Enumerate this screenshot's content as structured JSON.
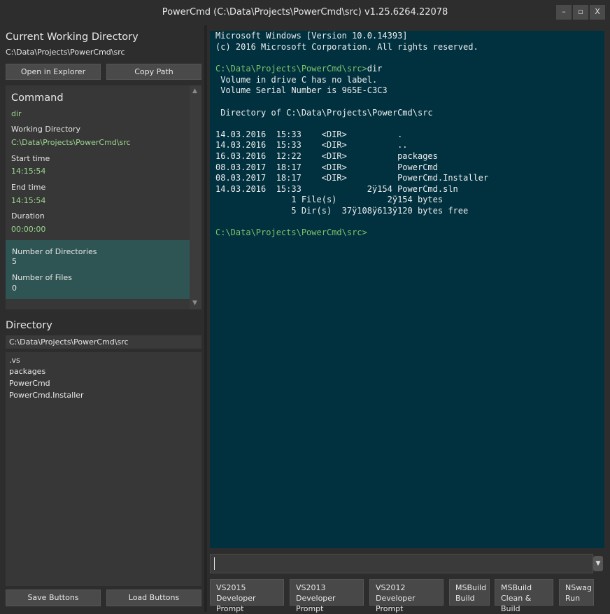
{
  "window": {
    "title": "PowerCmd (C:\\Data\\Projects\\PowerCmd\\src) v1.25.6264.22078",
    "minimize": "–",
    "maximize": "▫",
    "close": "X"
  },
  "cwd": {
    "heading": "Current Working Directory",
    "path": "C:\\Data\\Projects\\PowerCmd\\src",
    "open_explorer": "Open in Explorer",
    "copy_path": "Copy Path"
  },
  "command_info": {
    "heading": "Command",
    "command": "dir",
    "wd_label": "Working Directory",
    "wd_value": "C:\\Data\\Projects\\PowerCmd\\src",
    "start_label": "Start time",
    "start_value": "14:15:54",
    "end_label": "End time",
    "end_value": "14:15:54",
    "duration_label": "Duration",
    "duration_value": "00:00:00",
    "dirs_label": "Number of Directories",
    "dirs_value": "5",
    "files_label": "Number of Files",
    "files_value": "0"
  },
  "directory": {
    "heading": "Directory",
    "path": "C:\\Data\\Projects\\PowerCmd\\src",
    "items": [
      ".vs",
      "packages",
      "PowerCmd",
      "PowerCmd.Installer"
    ]
  },
  "bottom_buttons": {
    "save": "Save Buttons",
    "load": "Load Buttons"
  },
  "terminal": {
    "lines": [
      {
        "text": "Microsoft Windows [Version 10.0.14393]"
      },
      {
        "text": "(c) 2016 Microsoft Corporation. All rights reserved."
      },
      {
        "text": ""
      },
      {
        "prompt": "C:\\Data\\Projects\\PowerCmd\\src>",
        "text": "dir"
      },
      {
        "text": " Volume in drive C has no label."
      },
      {
        "text": " Volume Serial Number is 965E-C3C3"
      },
      {
        "text": ""
      },
      {
        "text": " Directory of C:\\Data\\Projects\\PowerCmd\\src"
      },
      {
        "text": ""
      },
      {
        "text": "14.03.2016  15:33    <DIR>          ."
      },
      {
        "text": "14.03.2016  15:33    <DIR>          .."
      },
      {
        "text": "16.03.2016  12:22    <DIR>          packages"
      },
      {
        "text": "08.03.2017  18:17    <DIR>          PowerCmd"
      },
      {
        "text": "08.03.2017  18:17    <DIR>          PowerCmd.Installer"
      },
      {
        "text": "14.03.2016  15:33             2ÿ154 PowerCmd.sln"
      },
      {
        "text": "               1 File(s)          2ÿ154 bytes"
      },
      {
        "text": "               5 Dir(s)  37ÿ108ÿ613ÿ120 bytes free"
      },
      {
        "text": ""
      },
      {
        "prompt": "C:\\Data\\Projects\\PowerCmd\\src>",
        "text": ""
      }
    ]
  },
  "quick_buttons": [
    {
      "line1": "VS2015",
      "line2": "Developer Prompt"
    },
    {
      "line1": "VS2013",
      "line2": "Developer Prompt"
    },
    {
      "line1": "VS2012",
      "line2": "Developer Prompt"
    },
    {
      "line1": "MSBuild",
      "line2": "Build"
    },
    {
      "line1": "MSBuild",
      "line2": "Clean & Build"
    },
    {
      "line1": "NSwag",
      "line2": "Run"
    }
  ]
}
